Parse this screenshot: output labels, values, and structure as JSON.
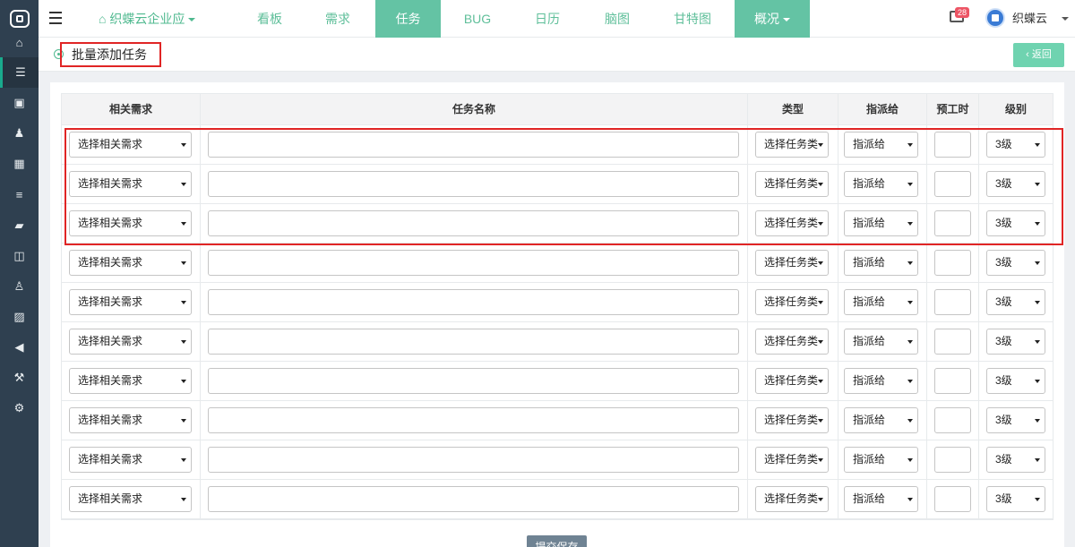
{
  "sidebar": {
    "icons": [
      "home-icon",
      "list-icon",
      "briefcase-icon",
      "users-icon",
      "calendar-icon",
      "server-icon",
      "book-icon",
      "columns-icon",
      "person-icon",
      "image-icon",
      "bullhorn-icon",
      "gavel-icon",
      "cogs-icon"
    ],
    "glyphs": [
      "⌂",
      "☰",
      "▣",
      "♟",
      "▦",
      "≡",
      "▰",
      "◫",
      "♙",
      "▨",
      "◀",
      "⚒",
      "⚙"
    ]
  },
  "topbar": {
    "brand": "织蝶云企业应",
    "tabs": [
      "看板",
      "需求",
      "任务",
      "BUG",
      "日历",
      "脑图",
      "甘特图",
      "概况"
    ],
    "active_tab": "任务",
    "mail_count": "28",
    "user_name": "织蝶云"
  },
  "page": {
    "title": "批量添加任务",
    "back_label": "返回",
    "back_icon": "‹"
  },
  "table": {
    "headers": [
      "相关需求",
      "任务名称",
      "类型",
      "指派给",
      "预工时",
      "级别"
    ],
    "rows": [
      {
        "requirement": "选择相关需求",
        "name": "",
        "type": "选择任务类",
        "assignee": "指派给",
        "hours": "",
        "level": "3级"
      },
      {
        "requirement": "选择相关需求",
        "name": "",
        "type": "选择任务类",
        "assignee": "指派给",
        "hours": "",
        "level": "3级"
      },
      {
        "requirement": "选择相关需求",
        "name": "",
        "type": "选择任务类",
        "assignee": "指派给",
        "hours": "",
        "level": "3级"
      },
      {
        "requirement": "选择相关需求",
        "name": "",
        "type": "选择任务类",
        "assignee": "指派给",
        "hours": "",
        "level": "3级"
      },
      {
        "requirement": "选择相关需求",
        "name": "",
        "type": "选择任务类",
        "assignee": "指派给",
        "hours": "",
        "level": "3级"
      },
      {
        "requirement": "选择相关需求",
        "name": "",
        "type": "选择任务类",
        "assignee": "指派给",
        "hours": "",
        "level": "3级"
      },
      {
        "requirement": "选择相关需求",
        "name": "",
        "type": "选择任务类",
        "assignee": "指派给",
        "hours": "",
        "level": "3级"
      },
      {
        "requirement": "选择相关需求",
        "name": "",
        "type": "选择任务类",
        "assignee": "指派给",
        "hours": "",
        "level": "3级"
      },
      {
        "requirement": "选择相关需求",
        "name": "",
        "type": "选择任务类",
        "assignee": "指派给",
        "hours": "",
        "level": "3级"
      },
      {
        "requirement": "选择相关需求",
        "name": "",
        "type": "选择任务类",
        "assignee": "指派给",
        "hours": "",
        "level": "3级"
      }
    ]
  },
  "footer": {
    "submit_label": "提交保存"
  },
  "colors": {
    "sidebar_bg": "#2f4050",
    "accent": "#64c3a4",
    "annotation_red": "#e02525"
  }
}
